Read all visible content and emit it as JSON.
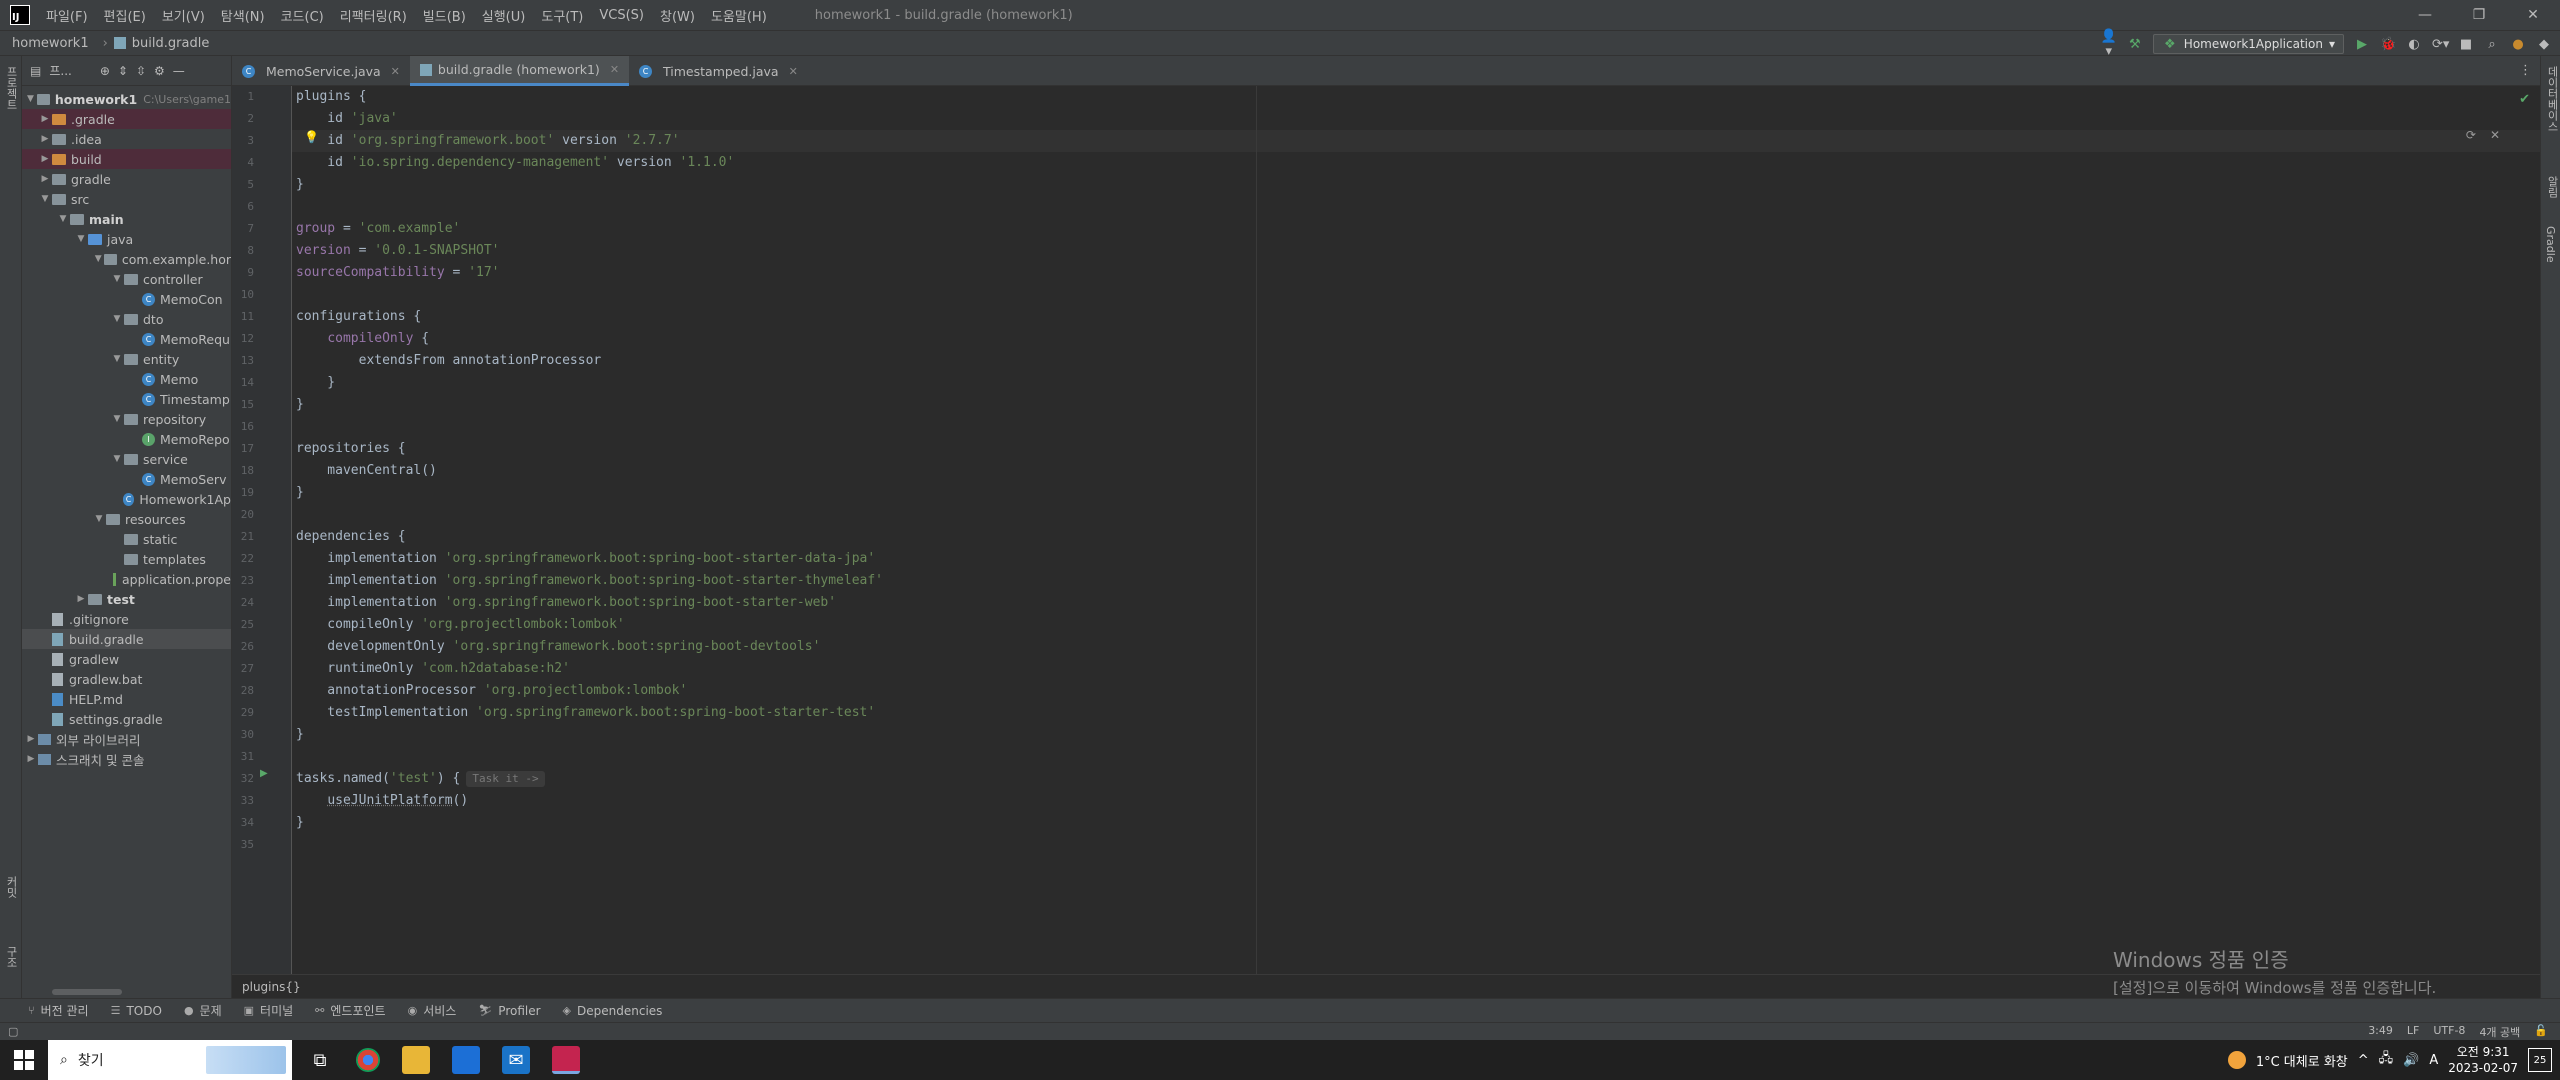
{
  "app": {
    "window_title": "homework1 - build.gradle (homework1)",
    "menu": [
      "파일(F)",
      "편집(E)",
      "보기(V)",
      "탐색(N)",
      "코드(C)",
      "리팩터링(R)",
      "빌드(B)",
      "실행(U)",
      "도구(T)",
      "VCS(S)",
      "창(W)",
      "도움말(H)"
    ]
  },
  "navbar": {
    "project": "homework1",
    "file": "build.gradle",
    "run_config": "Homework1Application"
  },
  "left_strip": {
    "project_label": "프로젝트",
    "commit_label": "커밋",
    "structure_label": "구조"
  },
  "right_strip": {
    "notifications": "알림",
    "database": "데이터베이스",
    "gradle": "Gradle"
  },
  "project_panel": {
    "title": "프...",
    "tree": [
      {
        "label": "homework1",
        "hint": "C:\\Users\\game1",
        "bold": true
      },
      {
        "label": ".gradle"
      },
      {
        "label": ".idea"
      },
      {
        "label": "build"
      },
      {
        "label": "gradle"
      },
      {
        "label": "src"
      },
      {
        "label": "main"
      },
      {
        "label": "java"
      },
      {
        "label": "com.example.hor"
      },
      {
        "label": "controller"
      },
      {
        "label": "MemoCon"
      },
      {
        "label": "dto"
      },
      {
        "label": "MemoRequ"
      },
      {
        "label": "entity"
      },
      {
        "label": "Memo"
      },
      {
        "label": "Timestamp"
      },
      {
        "label": "repository"
      },
      {
        "label": "MemoRepo"
      },
      {
        "label": "service"
      },
      {
        "label": "MemoServ"
      },
      {
        "label": "Homework1Ap"
      },
      {
        "label": "resources"
      },
      {
        "label": "static"
      },
      {
        "label": "templates"
      },
      {
        "label": "application.prope"
      },
      {
        "label": "test"
      },
      {
        "label": ".gitignore"
      },
      {
        "label": "build.gradle"
      },
      {
        "label": "gradlew"
      },
      {
        "label": "gradlew.bat"
      },
      {
        "label": "HELP.md"
      },
      {
        "label": "settings.gradle"
      },
      {
        "label": "외부 라이브러리"
      },
      {
        "label": "스크래치 및 콘솔"
      }
    ]
  },
  "tabs": [
    {
      "label": "MemoService.java"
    },
    {
      "label": "build.gradle (homework1)"
    },
    {
      "label": "Timestamped.java"
    }
  ],
  "editor": {
    "line_numbers": [
      "1",
      "2",
      "3",
      "4",
      "5",
      "6",
      "7",
      "8",
      "9",
      "10",
      "11",
      "12",
      "13",
      "14",
      "15",
      "16",
      "17",
      "18",
      "19",
      "20",
      "21",
      "22",
      "23",
      "24",
      "25",
      "26",
      "27",
      "28",
      "29",
      "30",
      "31",
      "32",
      "33",
      "34",
      "35"
    ],
    "inlay_hint": "Task it ->",
    "breadcrumb": "plugins{}"
  },
  "bottom_tools": [
    "버전 관리",
    "TODO",
    "문제",
    "터미널",
    "엔드포인트",
    "서비스",
    "Profiler",
    "Dependencies"
  ],
  "status": {
    "position": "3:49",
    "line_sep": "LF",
    "encoding": "UTF-8",
    "indent": "4개 공백"
  },
  "watermark": {
    "title": "Windows 정품 인증",
    "subtitle": "[설정]으로 이동하여 Windows를 정품 인증합니다."
  },
  "taskbar": {
    "search_placeholder": "찾기",
    "weather": "1°C  대체로 화창",
    "ime": "A",
    "time": "오전 9:31",
    "date": "2023-02-07",
    "notif_count": "25"
  }
}
